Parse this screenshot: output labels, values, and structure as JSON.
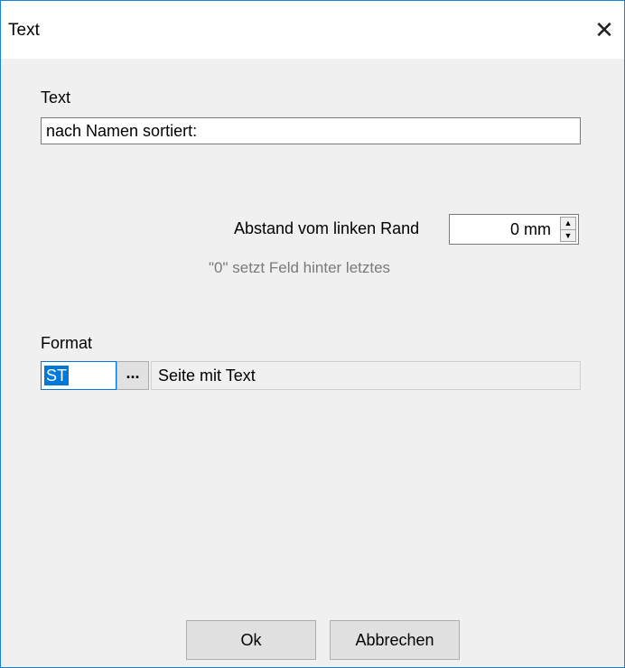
{
  "window": {
    "title": "Text",
    "close_glyph": "✕"
  },
  "text_section": {
    "label": "Text",
    "value": "nach Namen sortiert:"
  },
  "margin": {
    "label": "Abstand vom linken Rand",
    "value": "0 mm",
    "hint": "\"0\" setzt Feld hinter letztes",
    "up_glyph": "▲",
    "down_glyph": "▼"
  },
  "format": {
    "label": "Format",
    "code": "ST",
    "browse_label": "...",
    "description": "Seite mit Text"
  },
  "buttons": {
    "ok": "Ok",
    "cancel": "Abbrechen"
  },
  "icons": {
    "close": "close-icon",
    "spin_up": "arrow-up-icon",
    "spin_down": "arrow-down-icon"
  },
  "colors": {
    "accent": "#0078d7",
    "dialog_bg": "#f0f0f0",
    "hint_text": "#7a7a7a"
  }
}
